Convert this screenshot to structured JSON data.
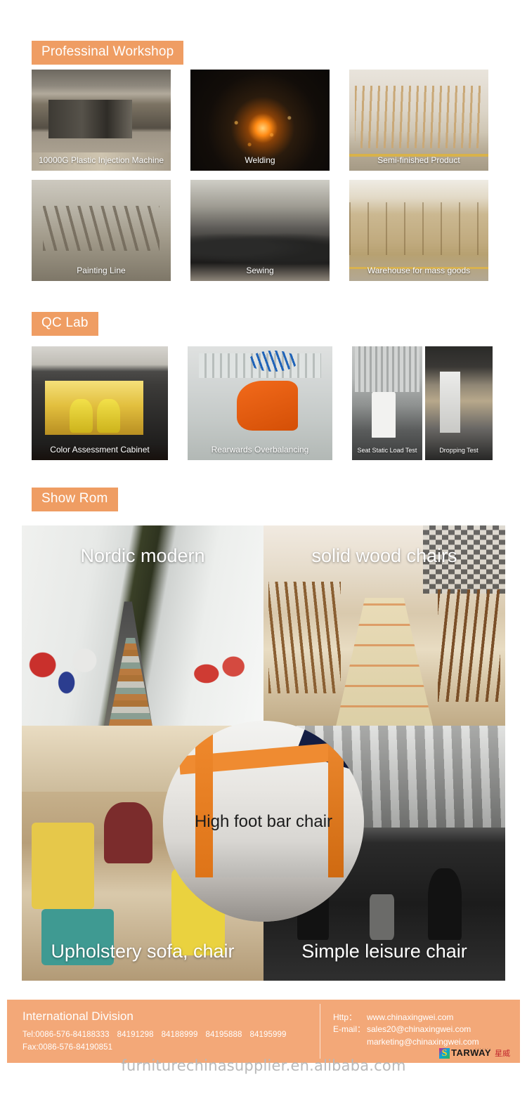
{
  "sections": {
    "workshop": {
      "heading": "Professinal Workshop",
      "tiles": [
        {
          "caption": "10000G Plastic Injection Machine",
          "art": "ph-inject"
        },
        {
          "caption": "Welding",
          "art": "ph-weld"
        },
        {
          "caption": "Semi-finished Product",
          "art": "ph-semi"
        },
        {
          "caption": "Painting Line",
          "art": "ph-paint"
        },
        {
          "caption": "Sewing",
          "art": "ph-sew"
        },
        {
          "caption": "Warehouse for mass goods",
          "art": "ph-ware"
        }
      ]
    },
    "qclab": {
      "heading": "QC Lab",
      "tiles": [
        {
          "caption": "Color Assessment Cabinet"
        },
        {
          "caption": "Rearwards Overbalancing"
        },
        {
          "caption": "Seat Static Load Test"
        },
        {
          "caption": "Dropping Test"
        }
      ]
    },
    "showroom": {
      "heading": "Show Rom",
      "cells": [
        {
          "label": "Nordic modern"
        },
        {
          "label": "solid wood chairs"
        },
        {
          "label": "Upholstery sofa, chair"
        },
        {
          "label": "Simple leisure chair"
        }
      ],
      "circle_label": "High foot bar chair"
    }
  },
  "footer": {
    "division_title": "International Division",
    "tel_label": "Tel:0086-576-84188333",
    "tel_extra": [
      "84191298",
      "84188999",
      "84195888",
      "84195999"
    ],
    "fax": "Fax:0086-576-84190851",
    "http_label": "Http：",
    "http_value": "www.chinaxingwei.com",
    "email_label": "E-mail：",
    "email_value": "sales20@chinaxingwei.com",
    "email_value2": "marketing@chinaxingwei.com",
    "logo": {
      "initial": "S",
      "word": "TARWAY",
      "cn": "星威",
      "dots": "......."
    }
  },
  "watermark": "furniturechinasupplier.en.alibaba.com",
  "colors": {
    "accent": "#ef9d63",
    "footer_bg": "#f3a878",
    "watermark": "#b9b9b9"
  }
}
